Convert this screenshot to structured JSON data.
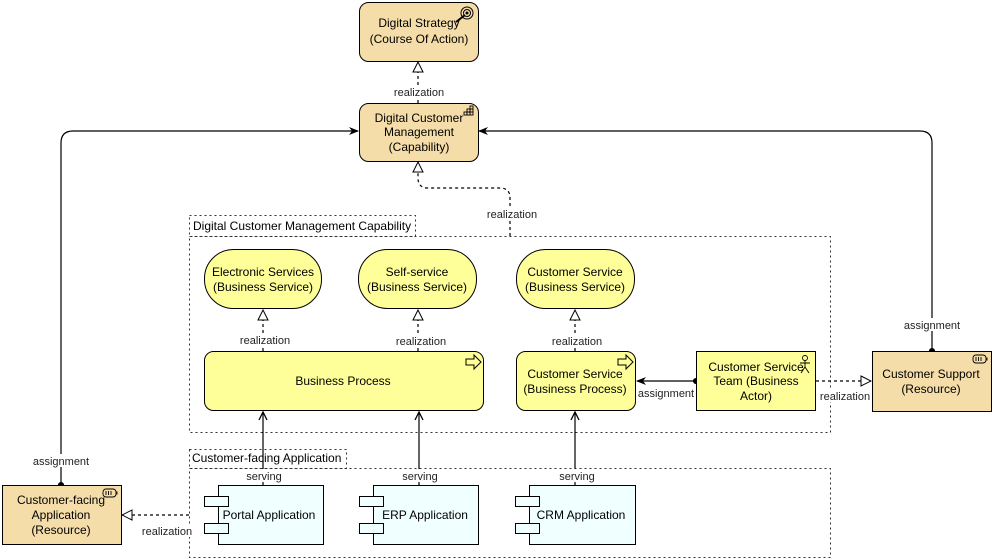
{
  "colors": {
    "resource": "#f5dda9",
    "business": "#ffff99",
    "application": "#f0ffff"
  },
  "nodes": {
    "digital_strategy": {
      "line1": "Digital Strategy",
      "line2": "(Course Of Action)",
      "icon": "target-icon"
    },
    "dcm": {
      "line1": "Digital Customer",
      "line2": "Management",
      "line3": "(Capability)",
      "icon": "capability-icon"
    },
    "electronic_services": {
      "line1": "Electronic Services",
      "line2": "(Business Service)"
    },
    "self_service": {
      "line1": "Self-service",
      "line2": "(Business Service)"
    },
    "customer_service": {
      "line1": "Customer Service",
      "line2": "(Business Service)"
    },
    "business_process": {
      "line1": "Business Process",
      "icon": "process-arrow-icon"
    },
    "cs_process": {
      "line1": "Customer Service",
      "line2": "(Business Process)",
      "icon": "process-arrow-icon"
    },
    "cs_team": {
      "line1": "Customer Service",
      "line2": "Team (Business",
      "line3": "Actor)",
      "icon": "actor-icon"
    },
    "customer_support": {
      "line1": "Customer Support",
      "line2": "(Resource)",
      "icon": "resource-icon"
    },
    "cf_app_resource": {
      "line1": "Customer-facing",
      "line2": "Application",
      "line3": "(Resource)",
      "icon": "resource-icon"
    },
    "portal": {
      "line1": "Portal Application",
      "icon": "component-icon"
    },
    "erp": {
      "line1": "ERP Application",
      "icon": "component-icon"
    },
    "crm": {
      "line1": "CRM Application",
      "icon": "component-icon"
    }
  },
  "groups": {
    "capability": "Digital Customer Management Capability",
    "application": "Customer-facing Application"
  },
  "edges": {
    "dcm_ds": "realization",
    "group_dcm": "realization",
    "bp_es": "realization",
    "bp_ss": "realization",
    "csp_cs": "realization",
    "team_csp": "assignment",
    "team_support": "realization",
    "support_dcm": "assignment",
    "cfapp_dcm": "assignment",
    "portal_bp": "serving",
    "erp_bp": "serving",
    "crm_csp": "serving",
    "appgroup_cfapp": "realization"
  }
}
